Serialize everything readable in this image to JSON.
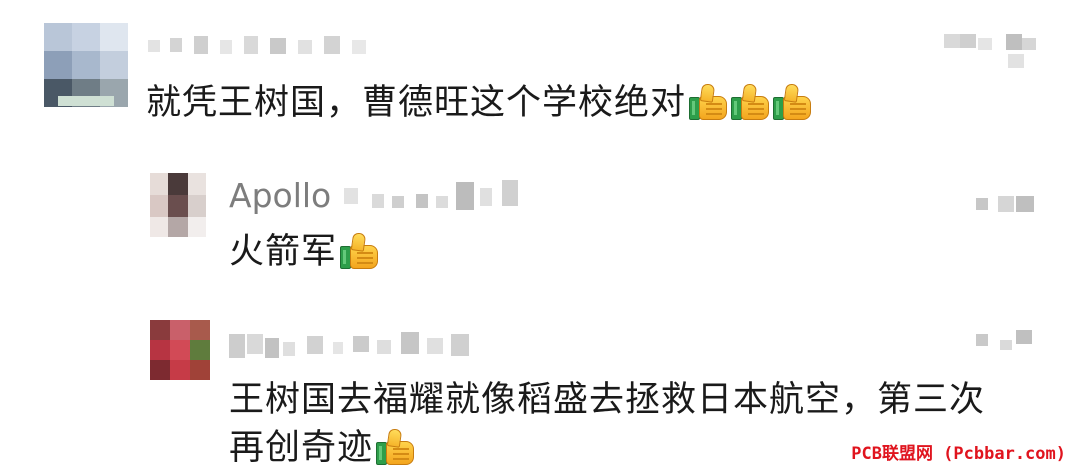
{
  "comments": [
    {
      "text": "就凭王树国，曹德旺这个学校绝对",
      "reactions": [
        "thumbs-up",
        "thumbs-up",
        "thumbs-up"
      ]
    },
    {
      "username": "Apollo",
      "text": "火箭军",
      "reactions": [
        "thumbs-up"
      ]
    },
    {
      "text_line1": "王树国去福耀就像稻盛去拯救日本航空，第三次",
      "text_line2": "再创奇迹",
      "reactions": [
        "thumbs-up"
      ]
    }
  ],
  "watermark": "PCB联盟网 (Pcbbar.com)",
  "colors": {
    "text": "#1a1a1a",
    "username": "#7d7d7d",
    "watermark": "#e0141e",
    "background": "#ffffff"
  }
}
